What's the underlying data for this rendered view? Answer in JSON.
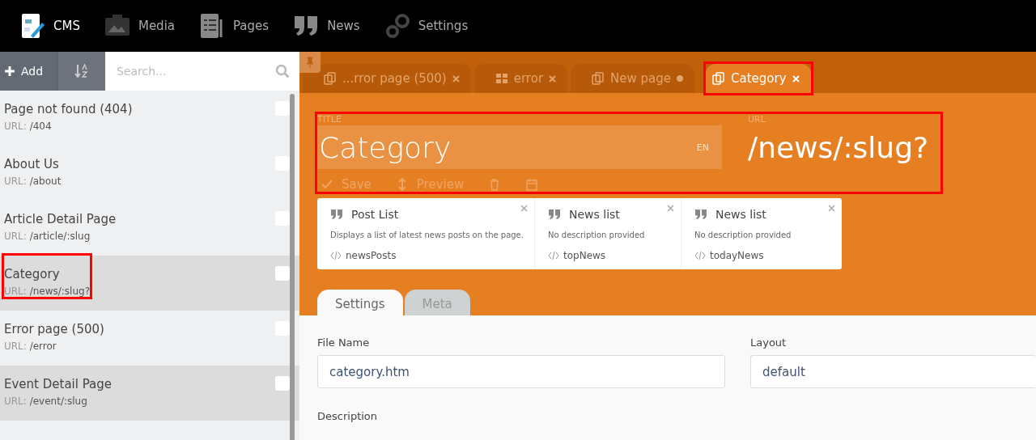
{
  "top_nav": [
    {
      "label": "CMS",
      "selected": true
    },
    {
      "label": "Media",
      "selected": false
    },
    {
      "label": "Pages",
      "selected": false
    },
    {
      "label": "News",
      "selected": false
    },
    {
      "label": "Settings",
      "selected": false
    }
  ],
  "sidebar": {
    "add_label": "Add",
    "search": {
      "placeholder": "Search..."
    },
    "items": [
      {
        "title": "Page not found (404)",
        "url_label": "URL:",
        "url": "/404",
        "selected": false,
        "checked": false,
        "annotated": false
      },
      {
        "title": "About Us",
        "url_label": "URL:",
        "url": "/about",
        "selected": false,
        "checked": false,
        "annotated": false
      },
      {
        "title": "Article Detail Page",
        "url_label": "URL:",
        "url": "/article/:slug",
        "selected": false,
        "checked": false,
        "annotated": false
      },
      {
        "title": "Category",
        "url_label": "URL:",
        "url": "/news/:slug?",
        "selected": true,
        "checked": false,
        "annotated": true
      },
      {
        "title": "Error page (500)",
        "url_label": "URL:",
        "url": "/error",
        "selected": false,
        "checked": false,
        "annotated": false
      },
      {
        "title": "Event Detail Page",
        "url_label": "URL:",
        "url": "/event/:slug",
        "selected": true,
        "checked": false,
        "annotated": false
      }
    ]
  },
  "tabs": [
    {
      "label": "...rror page (500)",
      "kind": "page",
      "modified": false,
      "selected": false,
      "annotated": false
    },
    {
      "label": "error",
      "kind": "layout",
      "modified": false,
      "selected": false,
      "annotated": false
    },
    {
      "label": "New page",
      "kind": "page",
      "modified": true,
      "selected": false,
      "annotated": false
    },
    {
      "label": "Category",
      "kind": "page",
      "modified": false,
      "selected": true,
      "annotated": true
    }
  ],
  "editor": {
    "annotated": true,
    "title_label": "TITLE",
    "title_value": "Category",
    "lang": "EN",
    "url_label": "URL",
    "url_value": "/news/:slug?",
    "toolbar": [
      {
        "kind": "text",
        "label": "Save",
        "disabled": true
      },
      {
        "kind": "text",
        "label": "Preview",
        "disabled": true
      },
      {
        "kind": "icon",
        "disabled": true
      },
      {
        "kind": "icon",
        "disabled": true
      }
    ],
    "components": [
      {
        "name": "Post List",
        "description": "Displays a list of latest news posts on the page.",
        "alias": "newsPosts"
      },
      {
        "name": "News list",
        "description": "No description provided",
        "alias": "topNews"
      },
      {
        "name": "News list",
        "description": "No description provided",
        "alias": "todayNews"
      }
    ],
    "form_tabs": [
      {
        "label": "Settings",
        "selected": true
      },
      {
        "label": "Meta",
        "selected": false
      }
    ],
    "fields": [
      {
        "label": "File Name",
        "value": "category.htm"
      },
      {
        "label": "Layout",
        "value": "default"
      }
    ],
    "description_label": "Description"
  }
}
